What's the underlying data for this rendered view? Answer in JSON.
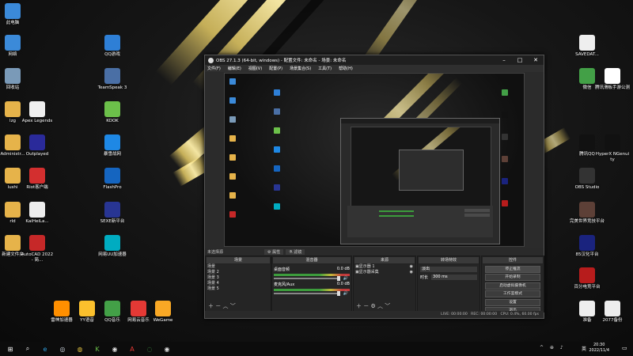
{
  "desktop_icons_left": [
    {
      "label": "此电脑",
      "icon": "computer-icon",
      "color": "#3b8ad9"
    },
    {
      "label": "网络",
      "icon": "network-icon",
      "color": "#3b8ad9"
    },
    {
      "label": "回收站",
      "icon": "recycle-bin-icon",
      "color": "#7a9ab8"
    },
    {
      "label": "lzg",
      "icon": "folder-icon",
      "color": "#e6b34a"
    },
    {
      "label": "Administr...",
      "icon": "folder-icon",
      "color": "#e6b34a"
    },
    {
      "label": "lushi",
      "icon": "folder-icon",
      "color": "#e6b34a"
    },
    {
      "label": "rld",
      "icon": "folder-icon",
      "color": "#e6b34a"
    },
    {
      "label": "新建文件夹",
      "icon": "folder-icon",
      "color": "#e6b34a"
    }
  ],
  "desktop_icons_col2": [
    {
      "label": "Apex Legends",
      "icon": "file-icon",
      "color": "#eeeeee"
    },
    {
      "label": "Outplayed",
      "icon": "outplayed-icon",
      "color": "#2a2a9a"
    },
    {
      "label": "Riot客户端",
      "icon": "riot-icon",
      "color": "#d32f2f"
    },
    {
      "label": "KaiHeiLa...",
      "icon": "file-icon",
      "color": "#eeeeee"
    },
    {
      "label": "AutoCAD 2022 - 简...",
      "icon": "autocad-icon",
      "color": "#c62828"
    }
  ],
  "desktop_icons_col3": [
    {
      "label": "QQ游戏",
      "icon": "qq-game-icon",
      "color": "#2e7fd6"
    },
    {
      "label": "TeamSpeak 3",
      "icon": "teamspeak-icon",
      "color": "#4a6fa5"
    },
    {
      "label": "KOOK",
      "icon": "kook-icon",
      "color": "#6cc04a"
    },
    {
      "label": "暴雪战网",
      "icon": "battlenet-icon",
      "color": "#1e88e5"
    },
    {
      "label": "FlashPro",
      "icon": "flash-icon",
      "color": "#1565c0"
    },
    {
      "label": "SEXE新平台",
      "icon": "se-icon",
      "color": "#283593"
    },
    {
      "label": "网易UU加速器",
      "icon": "uu-icon",
      "color": "#00acc1"
    }
  ],
  "desktop_icons_bottom": [
    {
      "label": "雷神加速器",
      "icon": "leishen-icon",
      "color": "#ff8f00"
    },
    {
      "label": "YY语音",
      "icon": "yy-icon",
      "color": "#fbc02d"
    },
    {
      "label": "QQ音乐",
      "icon": "qq-music-icon",
      "color": "#43a047"
    },
    {
      "label": "网易云音乐",
      "icon": "netease-music-icon",
      "color": "#e53935"
    },
    {
      "label": "WeGame",
      "icon": "wegame-icon",
      "color": "#f9a825"
    }
  ],
  "desktop_icons_right_col1": [
    {
      "label": "微信",
      "icon": "wechat-icon",
      "color": "#43a047"
    },
    {
      "label": "腾讯QQ",
      "icon": "qq-icon",
      "color": "#111111"
    },
    {
      "label": "OBS Studio",
      "icon": "obs-icon",
      "color": "#333333"
    },
    {
      "label": "完美世界竞技平台",
      "icon": "perfect-world-icon",
      "color": "#5d4037"
    },
    {
      "label": "85汉化平台",
      "icon": "app-85-icon",
      "color": "#1a237e"
    },
    {
      "label": "百分电竞平台",
      "icon": "esports-icon",
      "color": "#b71c1c"
    },
    {
      "label": "准备",
      "icon": "file-icon",
      "color": "#eeeeee"
    }
  ],
  "desktop_icons_right_col2": [
    {
      "label": "SAVEDAT...",
      "icon": "file-icon",
      "color": "#eeeeee"
    },
    {
      "label": "腾讯滑板手游公测",
      "icon": "pdf-icon",
      "color": "#ffffff"
    },
    {
      "label": "HyperX NGenuity",
      "icon": "hyperx-icon",
      "color": "#111111"
    },
    {
      "label": "2077备份",
      "icon": "file-icon",
      "color": "#eeeeee"
    }
  ],
  "obs": {
    "title": "OBS 27.1.3 (64-bit, windows) - 配置文件: 未命名 - 场景: 未命名",
    "menu": [
      "文件(F)",
      "编辑(E)",
      "视图(V)",
      "配置(P)",
      "场景集合(S)",
      "工具(T)",
      "帮助(H)"
    ],
    "source_label_left": "未选择源",
    "props_btn": "属性",
    "filters_btn": "滤镜",
    "docks": {
      "scenes": {
        "title": "场景",
        "items": [
          "场景",
          "场景 2",
          "场景 3",
          "场景 4",
          "场景 5"
        ]
      },
      "mixer": {
        "title": "混音器",
        "channels": [
          {
            "name": "桌面音频",
            "level": "0.0 dB"
          },
          {
            "name": "麦克风/Aux",
            "level": "0.0 dB"
          }
        ]
      },
      "sources": {
        "title": "来源",
        "items": [
          "显示器 1",
          "显示器采集"
        ]
      },
      "transitions": {
        "title": "转场特效",
        "type": "淡出",
        "duration_label": "时长",
        "duration": "300 ms"
      },
      "controls": {
        "title": "控件",
        "buttons": [
          "停止推流",
          "开始录制",
          "启动虚拟摄像机",
          "工作室模式",
          "设置",
          "退出"
        ]
      }
    },
    "status": {
      "live": "LIVE: 00:00:00",
      "rec": "REC: 00:00:00",
      "cpu": "CPU: 0.4%, 60.00 fps"
    }
  },
  "taskbar": {
    "apps": [
      "windows-start-icon",
      "search-icon",
      "edge-icon",
      "steam-icon",
      "chrome-icon",
      "kook-icon",
      "obs-icon",
      "autocad-icon",
      "wechat-icon",
      "obs-icon"
    ],
    "time": "20:30",
    "date": "2022/11/4",
    "ime": "英"
  }
}
